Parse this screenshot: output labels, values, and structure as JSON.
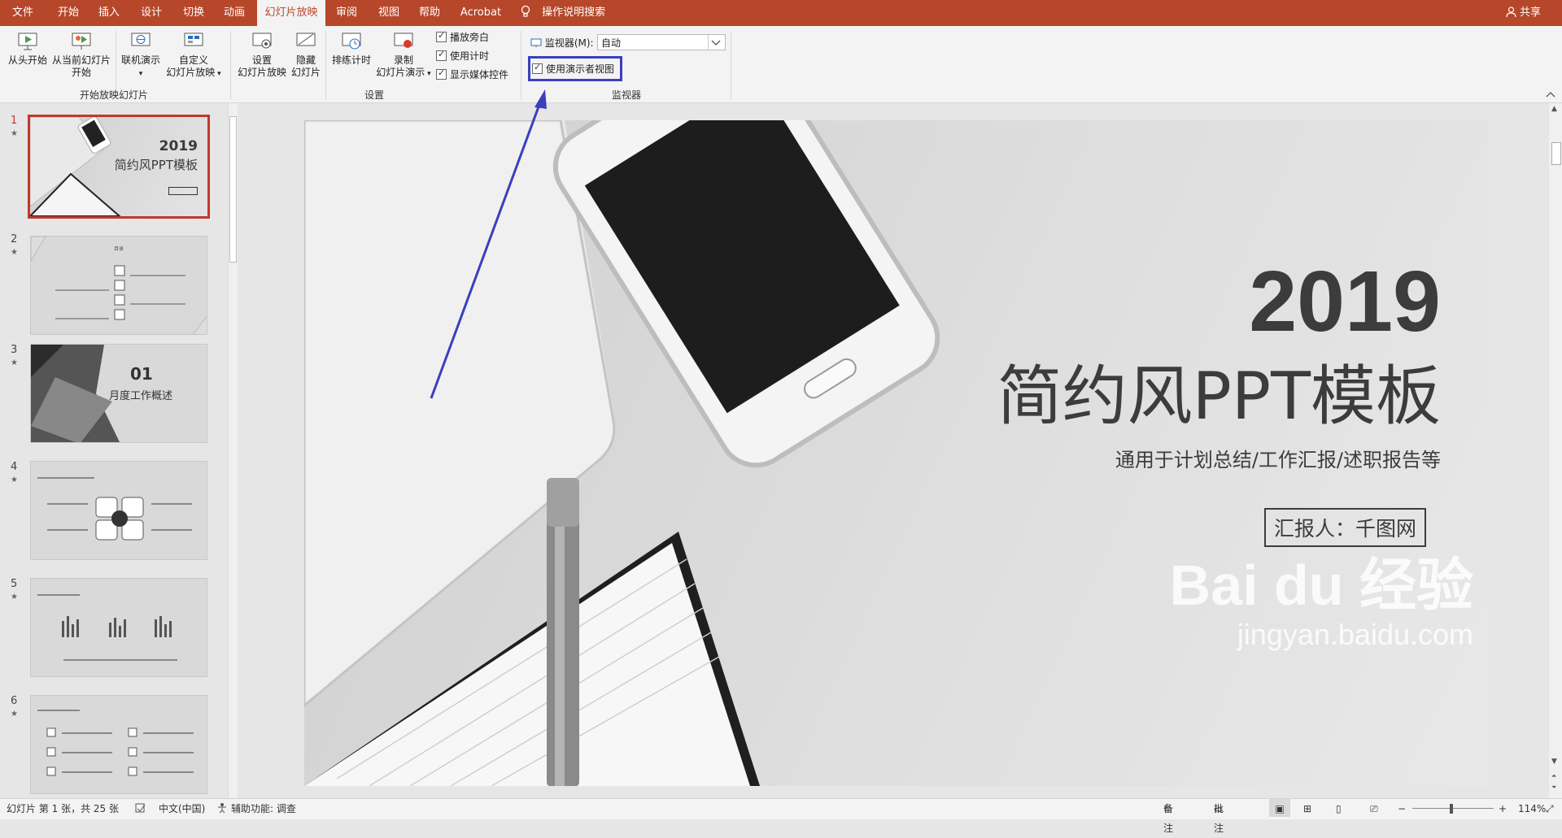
{
  "menubar": {
    "tabs": [
      "文件",
      "开始",
      "插入",
      "设计",
      "切换",
      "动画",
      "幻灯片放映",
      "审阅",
      "视图",
      "帮助",
      "Acrobat"
    ],
    "active_tab": "幻灯片放映",
    "search": "操作说明搜索",
    "share": "共享"
  },
  "ribbon": {
    "start_group": {
      "label": "开始放映幻灯片",
      "from_beginning": "从头开始",
      "from_current_l1": "从当前幻灯片",
      "from_current_l2": "开始",
      "online": "联机演示",
      "custom_l1": "自定义",
      "custom_l2": "幻灯片放映"
    },
    "setup_group": {
      "label": "设置",
      "setup_l1": "设置",
      "setup_l2": "幻灯片放映",
      "hide_l1": "隐藏",
      "hide_l2": "幻灯片",
      "rehearse": "排练计时",
      "record_l1": "录制",
      "record_l2": "幻灯片演示",
      "play_narrations": "播放旁白",
      "use_timings": "使用计时",
      "show_media_controls": "显示媒体控件"
    },
    "monitor_group": {
      "label": "监视器",
      "monitor_label": "监视器(M):",
      "monitor_value": "自动",
      "presenter_view": "使用演示者视图"
    }
  },
  "thumbnails": [
    {
      "num": "1",
      "title": "2019",
      "subtitle": "简约风PPT模板"
    },
    {
      "num": "2",
      "title": "目录"
    },
    {
      "num": "3",
      "title": "01",
      "subtitle": "月度工作概述"
    },
    {
      "num": "4"
    },
    {
      "num": "5"
    },
    {
      "num": "6"
    }
  ],
  "slide": {
    "year": "2019",
    "title": "简约风PPT模板",
    "subtitle": "通用于计划总结/工作汇报/述职报告等",
    "reporter": "汇报人：千图网"
  },
  "watermark": {
    "brand": "Bai du 经验",
    "url": "jingyan.baidu.com"
  },
  "status": {
    "slide_info": "幻灯片 第 1 张，共 25 张",
    "language": "中文(中国)",
    "accessibility": "辅助功能: 调查",
    "notes": "备注",
    "comments": "批注",
    "zoom": "114%"
  },
  "colors": {
    "ribbon_accent": "#b7472a",
    "annotation": "#3a3fbf",
    "selected_thumb_border": "#c0392b"
  }
}
